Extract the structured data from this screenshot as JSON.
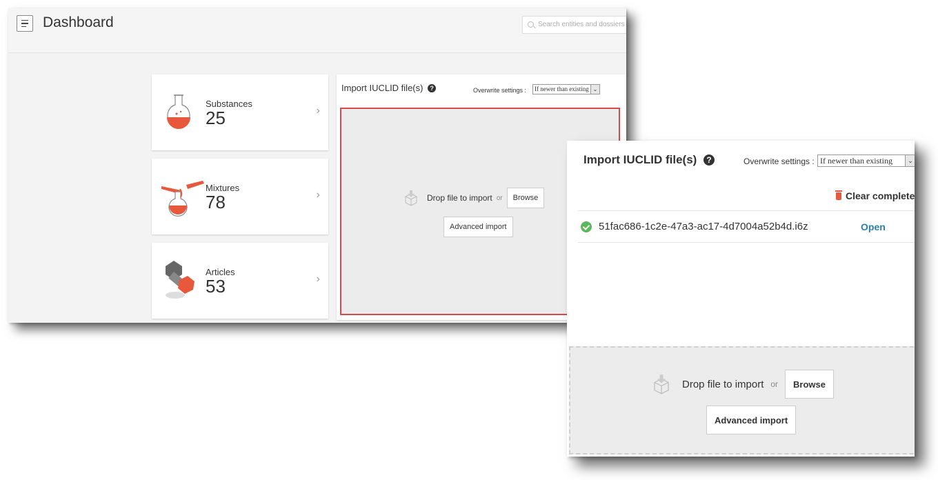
{
  "header": {
    "title": "Dashboard",
    "search_placeholder": "Search entities and dossiers"
  },
  "cards": [
    {
      "label": "Substances",
      "count": "25"
    },
    {
      "label": "Mixtures",
      "count": "78"
    },
    {
      "label": "Articles",
      "count": "53"
    }
  ],
  "import_panel": {
    "title": "Import IUCLID file(s)",
    "overwrite_label": "Overwrite settings :",
    "overwrite_value": "If newer than existing",
    "drop_text": "Drop file to import",
    "or_text": "or",
    "browse_label": "Browse",
    "advanced_label": "Advanced import",
    "dropzone_border_color": "#d84a4a"
  },
  "zoom_panel": {
    "title": "Import IUCLID file(s)",
    "overwrite_label": "Overwrite settings :",
    "overwrite_value": "If newer than existing",
    "clear_label": "Clear complete",
    "file_name": "51fac686-1c2e-47a3-ac17-4d7004a52b4d.i6z",
    "open_label": "Open",
    "drop_text": "Drop file to import",
    "or_text": "or",
    "browse_label": "Browse",
    "advanced_label": "Advanced import"
  },
  "icons": [
    "menu-icon",
    "search-icon",
    "flask-icon",
    "mixing-flasks-icon",
    "bolt-nut-icon",
    "chevron-right-icon",
    "help-icon",
    "box-upload-icon",
    "trash-icon",
    "check-circle-icon"
  ],
  "colors": {
    "accent_orange": "#e8583c",
    "success_green": "#5bb85d",
    "link_blue": "#2a7fa8"
  }
}
